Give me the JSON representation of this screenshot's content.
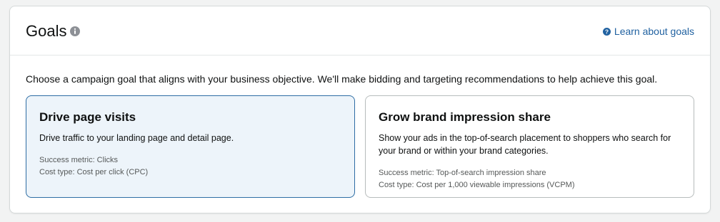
{
  "header": {
    "title": "Goals",
    "info_icon": "info-circle-icon",
    "learn_link": "Learn about goals",
    "learn_icon": "help-circle-icon"
  },
  "description": "Choose a campaign goal that aligns with your business objective. We'll make bidding and targeting recommendations to help achieve this goal.",
  "goals": [
    {
      "title": "Drive page visits",
      "description": "Drive traffic to your landing page and detail page.",
      "success_metric": "Success metric: Clicks",
      "cost_type": "Cost type: Cost per click (CPC)",
      "selected": true
    },
    {
      "title": "Grow brand impression share",
      "description": "Show your ads in the top-of-search placement to shoppers who search for your brand or within your brand categories.",
      "success_metric": "Success metric: Top-of-search impression share",
      "cost_type": "Cost type: Cost per 1,000 viewable impressions (VCPM)",
      "selected": false
    }
  ],
  "colors": {
    "link": "#2162a1",
    "selected_border": "#2e6da4",
    "selected_bg": "#edf4fa",
    "text": "#0f1111",
    "muted": "#565959"
  }
}
